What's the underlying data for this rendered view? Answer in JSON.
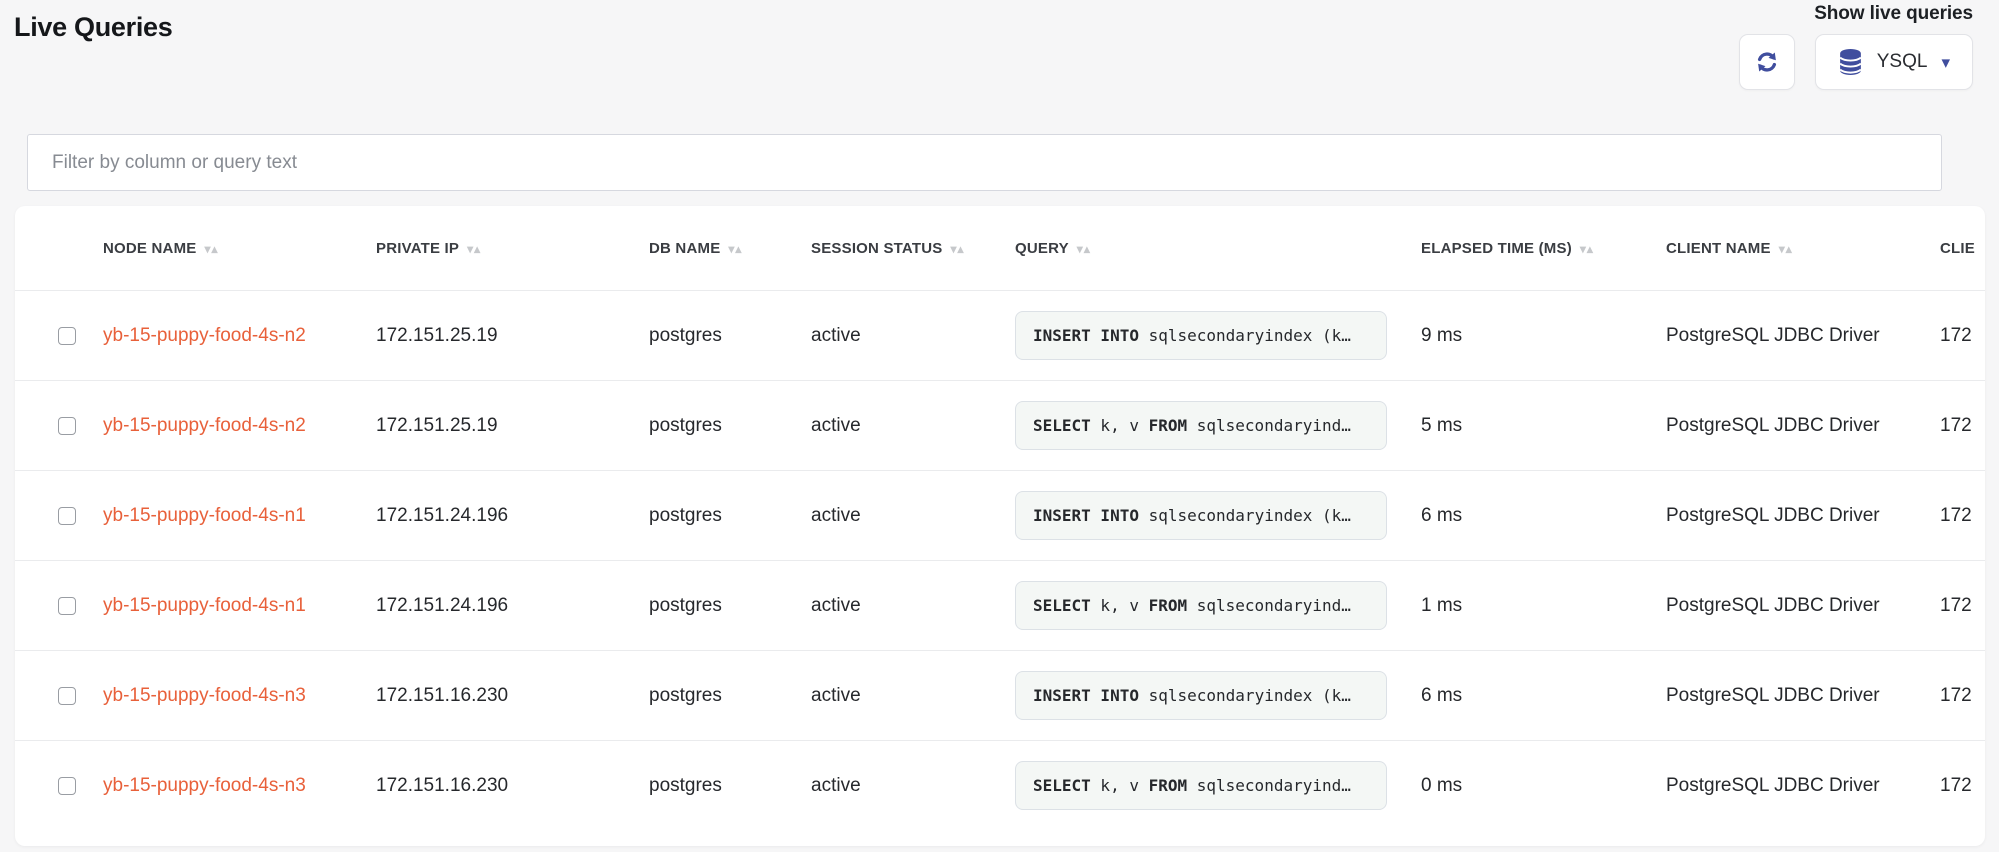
{
  "page": {
    "title": "Live Queries"
  },
  "toolbar": {
    "caption": "Show live queries",
    "refresh_icon": "refresh-icon",
    "api_button": {
      "icon": "database-icon",
      "label": "YSQL",
      "caret": "▾"
    }
  },
  "filter": {
    "placeholder": "Filter by column or query text",
    "value": ""
  },
  "colors": {
    "accent_orange": "#e8603a",
    "icon_indigo": "#404e9e",
    "page_bg": "#f6f6f7",
    "query_box_bg": "#f4f7f5",
    "query_box_border": "#dce1e6"
  },
  "table": {
    "sort_glyph": "▾▴",
    "columns": [
      "",
      "NODE NAME",
      "PRIVATE IP",
      "DB NAME",
      "SESSION STATUS",
      "QUERY",
      "ELAPSED TIME (MS)",
      "CLIENT NAME",
      "CLIE"
    ],
    "rows": [
      {
        "node_name": "yb-15-puppy-food-4s-n2",
        "private_ip": "172.151.25.19",
        "db_name": "postgres",
        "session_status": "active",
        "query": [
          {
            "text": "INSERT INTO",
            "bold": true
          },
          {
            "text": " sqlsecondaryindex (k…",
            "bold": false
          }
        ],
        "elapsed": "9 ms",
        "client_name": "PostgreSQL JDBC Driver",
        "client_host": "172"
      },
      {
        "node_name": "yb-15-puppy-food-4s-n2",
        "private_ip": "172.151.25.19",
        "db_name": "postgres",
        "session_status": "active",
        "query": [
          {
            "text": "SELECT",
            "bold": true
          },
          {
            "text": " k, v ",
            "bold": false
          },
          {
            "text": "FROM",
            "bold": true
          },
          {
            "text": " sqlsecondaryind…",
            "bold": false
          }
        ],
        "elapsed": "5 ms",
        "client_name": "PostgreSQL JDBC Driver",
        "client_host": "172"
      },
      {
        "node_name": "yb-15-puppy-food-4s-n1",
        "private_ip": "172.151.24.196",
        "db_name": "postgres",
        "session_status": "active",
        "query": [
          {
            "text": "INSERT INTO",
            "bold": true
          },
          {
            "text": " sqlsecondaryindex (k…",
            "bold": false
          }
        ],
        "elapsed": "6 ms",
        "client_name": "PostgreSQL JDBC Driver",
        "client_host": "172"
      },
      {
        "node_name": "yb-15-puppy-food-4s-n1",
        "private_ip": "172.151.24.196",
        "db_name": "postgres",
        "session_status": "active",
        "query": [
          {
            "text": "SELECT",
            "bold": true
          },
          {
            "text": " k, v ",
            "bold": false
          },
          {
            "text": "FROM",
            "bold": true
          },
          {
            "text": " sqlsecondaryind…",
            "bold": false
          }
        ],
        "elapsed": "1 ms",
        "client_name": "PostgreSQL JDBC Driver",
        "client_host": "172"
      },
      {
        "node_name": "yb-15-puppy-food-4s-n3",
        "private_ip": "172.151.16.230",
        "db_name": "postgres",
        "session_status": "active",
        "query": [
          {
            "text": "INSERT INTO",
            "bold": true
          },
          {
            "text": " sqlsecondaryindex (k…",
            "bold": false
          }
        ],
        "elapsed": "6 ms",
        "client_name": "PostgreSQL JDBC Driver",
        "client_host": "172"
      },
      {
        "node_name": "yb-15-puppy-food-4s-n3",
        "private_ip": "172.151.16.230",
        "db_name": "postgres",
        "session_status": "active",
        "query": [
          {
            "text": "SELECT",
            "bold": true
          },
          {
            "text": " k, v ",
            "bold": false
          },
          {
            "text": "FROM",
            "bold": true
          },
          {
            "text": " sqlsecondaryind…",
            "bold": false
          }
        ],
        "elapsed": "0 ms",
        "client_name": "PostgreSQL JDBC Driver",
        "client_host": "172"
      }
    ]
  }
}
